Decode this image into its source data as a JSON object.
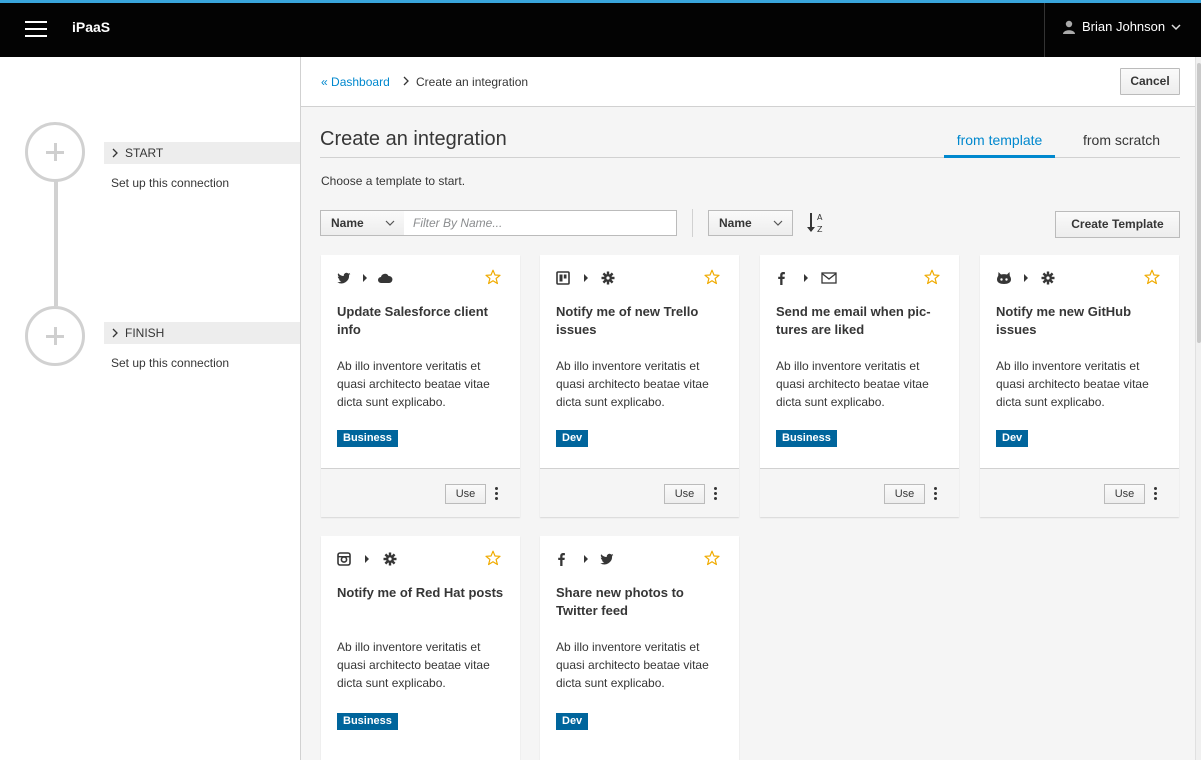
{
  "topbar": {
    "brand": "iPaaS",
    "user_name": "Brian Johnson",
    "accent_color": "#39a5dc"
  },
  "wizard": {
    "steps": [
      {
        "label": "START",
        "description": "Set up this connection"
      },
      {
        "label": "FINISH",
        "description": "Set up this connection"
      }
    ]
  },
  "breadcrumb": {
    "link_label": "Dashboard",
    "link_prefix": "«",
    "current": "Create an integration",
    "cancel_label": "Cancel"
  },
  "header": {
    "title": "Create an integration",
    "tabs": [
      {
        "label": "from template",
        "active": true
      },
      {
        "label": "from scratch",
        "active": false
      }
    ],
    "hint": "Choose a template to start."
  },
  "toolbar": {
    "filter_field": "Name",
    "filter_placeholder": "Filter By Name...",
    "sort_field": "Name",
    "sort_icon": "sort-alpha-asc-icon",
    "create_label": "Create Template"
  },
  "cards": [
    {
      "from_icon": "twitter-icon",
      "to_icon": "cloud-icon",
      "title": "Update Salesforce client info",
      "description": "Ab illo inventore veritatis et quasi architecto beatae vitae dicta sunt explicabo.",
      "tag": "Business",
      "use_label": "Use"
    },
    {
      "from_icon": "trello-icon",
      "to_icon": "gear-icon",
      "title": "Notify me of new Trello issues",
      "description": "Ab illo inventore veritatis et quasi architecto beatae vitae dicta sunt explicabo.",
      "tag": "Dev",
      "use_label": "Use"
    },
    {
      "from_icon": "facebook-icon",
      "to_icon": "envelope-icon",
      "title": "Send me email when pic-tures are liked",
      "description": "Ab illo inventore veritatis et quasi architecto beatae vitae dicta sunt explicabo.",
      "tag": "Business",
      "use_label": "Use"
    },
    {
      "from_icon": "github-icon",
      "to_icon": "gear-icon",
      "title": "Notify me new GitHub issues",
      "description": "Ab illo inventore veritatis et quasi architecto beatae vitae dicta sunt explicabo.",
      "tag": "Dev",
      "use_label": "Use"
    },
    {
      "from_icon": "instagram-icon",
      "to_icon": "gear-icon",
      "title": "Notify me of Red Hat posts",
      "description": "Ab illo inventore veritatis et quasi architecto beatae vitae dicta sunt explicabo.",
      "tag": "Business",
      "use_label": "Use"
    },
    {
      "from_icon": "facebook-icon",
      "to_icon": "twitter-icon",
      "title": "Share new photos to Twitter feed",
      "description": "Ab illo inventore veritatis et quasi architecto beatae vitae dicta sunt explicabo.",
      "tag": "Dev",
      "use_label": "Use"
    }
  ],
  "colors": {
    "link": "#0088ce",
    "badge": "#00659c",
    "star": "#f0ab00"
  }
}
